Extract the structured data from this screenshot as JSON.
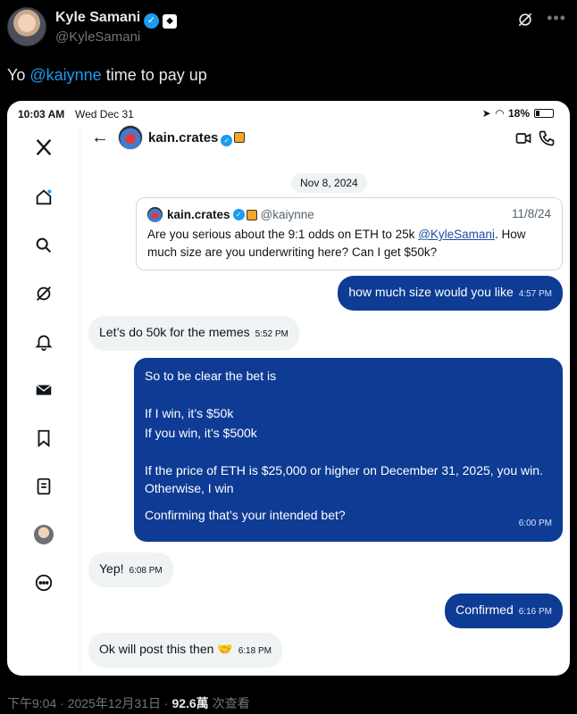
{
  "tweet": {
    "author_name": "Kyle Samani",
    "author_handle": "@KyleSamani",
    "text_prefix": "Yo ",
    "mention": "@kaiynne",
    "text_suffix": " time to pay up",
    "footer_time": "下午9:04 · 2025年12月31日",
    "footer_sep": " · ",
    "views": "92.6萬",
    "views_label": " 次查看"
  },
  "screenshot": {
    "status": {
      "time": "10:03 AM",
      "date": "Wed Dec 31",
      "battery": "18%"
    },
    "chat": {
      "name": "kain.crates",
      "date_chip": "Nov 8, 2024",
      "quote": {
        "name": "kain.crates",
        "handle": "@kaiynne",
        "date": "11/8/24",
        "text_before": "Are you serious about the 9:1 odds on ETH to 25k ",
        "link": "@KyleSamani",
        "text_after": ". How much size are you underwriting here? Can I get $50k?"
      },
      "messages": [
        {
          "text": "how much size would you like",
          "time": "4:57 PM"
        },
        {
          "text": "Let’s do 50k for the memes",
          "time": "5:52 PM"
        },
        {
          "lines": [
            "So to be clear the bet is",
            "If I win, it’s $50k",
            "If you win, it’s $500k",
            "If the price of ETH is $25,000 or higher on December 31, 2025, you win. Otherwise, I win",
            "Confirming that’s your intended bet?"
          ],
          "time": "6:00 PM"
        },
        {
          "text": "Yep!",
          "time": "6:08 PM"
        },
        {
          "text": "Confirmed",
          "time": "6:16 PM"
        },
        {
          "text": "Ok will post this then 🤝",
          "time": "6:18 PM"
        }
      ]
    }
  },
  "icons": {
    "nav": [
      "x-logo-icon",
      "home-icon",
      "search-icon",
      "grok-icon",
      "notifications-icon",
      "messages-icon",
      "bookmarks-icon",
      "lists-icon",
      "profile-avatar",
      "more-icon"
    ]
  }
}
